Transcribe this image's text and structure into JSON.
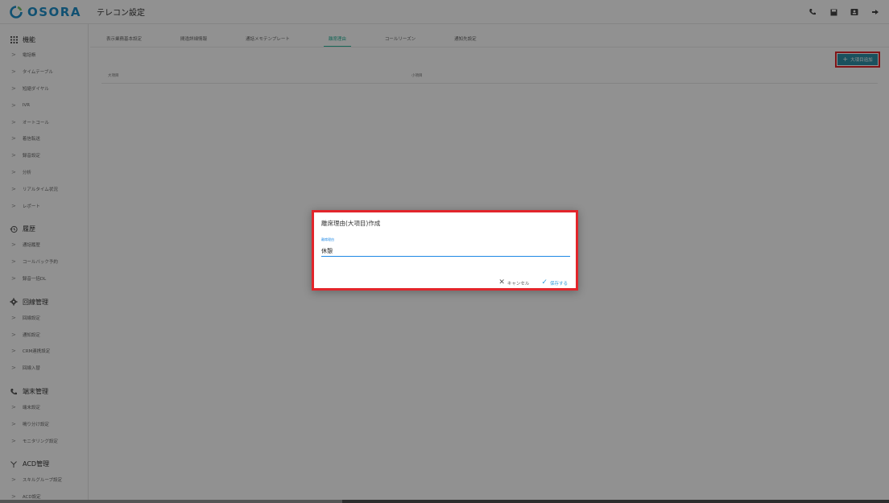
{
  "app": {
    "logo": "OSORA",
    "page_title": "テレコン設定"
  },
  "header_icons": [
    "phone-icon",
    "save-icon",
    "contact-card-icon",
    "logout-icon"
  ],
  "sidebar": {
    "sections": [
      {
        "title": "機能",
        "icon": "grid-icon",
        "items": [
          "電話帳",
          "タイムテーブル",
          "短縮ダイヤル",
          "IVR",
          "オートコール",
          "着信転送",
          "録音設定",
          "分析",
          "リアルタイム状況",
          "レポート"
        ]
      },
      {
        "title": "履歴",
        "icon": "history-icon",
        "items": [
          "通話履歴",
          "コールバック予約",
          "録音一括DL"
        ]
      },
      {
        "title": "回線管理",
        "icon": "gear-icon",
        "items": [
          "回線設定",
          "通知設定",
          "CRM連携設定",
          "回線入替"
        ]
      },
      {
        "title": "端末管理",
        "icon": "phone-icon",
        "items": [
          "端末設定",
          "鳴り分け設定",
          "モニタリング設定"
        ]
      },
      {
        "title": "ACD管理",
        "icon": "branch-icon",
        "items": [
          "スキルグループ設定",
          "ACD設定"
        ]
      }
    ]
  },
  "main": {
    "tabs": [
      {
        "label": "表示業務基本設定",
        "active": false
      },
      {
        "label": "間違詳細情報",
        "active": false
      },
      {
        "label": "通話メモテンプレート",
        "active": false
      },
      {
        "label": "離席理由",
        "active": true
      },
      {
        "label": "コールリーズン",
        "active": false
      },
      {
        "label": "通知先設定",
        "active": false
      }
    ],
    "add_button_label": "大項目追加",
    "table_headers": [
      "大項目",
      "小項目"
    ]
  },
  "modal": {
    "title": "離席理由(大項目)作成",
    "field_label": "離席理由",
    "field_value": "休憩",
    "cancel_label": "キャンセル",
    "save_label": "保存する"
  },
  "colors": {
    "brand": "#1f8fc8",
    "accent": "#2bb59b",
    "button": "#2e8fa6",
    "link": "#2f9bd8",
    "highlight": "#e2252b"
  }
}
